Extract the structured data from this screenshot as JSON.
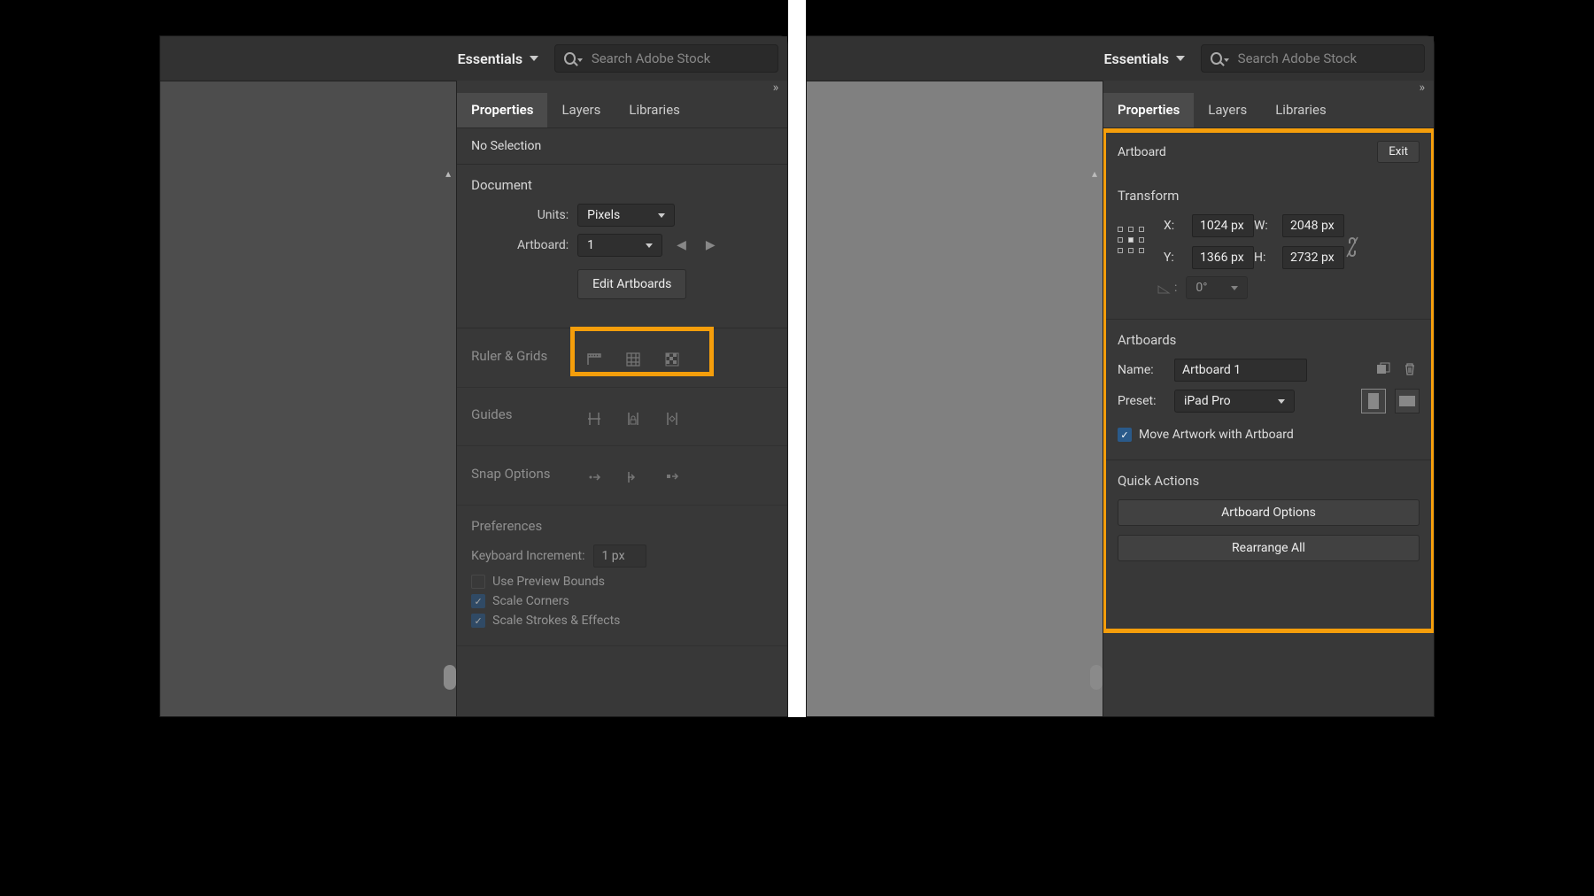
{
  "colors": {
    "highlight": "#f59e0b",
    "panel_bg": "#383838",
    "canvas_bg": "#4d4d4d"
  },
  "left": {
    "workspace_label": "Essentials",
    "search_placeholder": "Search Adobe Stock",
    "tabs": {
      "properties": "Properties",
      "layers": "Layers",
      "libraries": "Libraries"
    },
    "no_selection": "No Selection",
    "document": {
      "heading": "Document",
      "units_label": "Units:",
      "units_value": "Pixels",
      "artboard_label": "Artboard:",
      "artboard_value": "1",
      "edit_artboards_btn": "Edit Artboards"
    },
    "ruler_grids": "Ruler & Grids",
    "guides": "Guides",
    "snap_options": "Snap Options",
    "preferences": {
      "heading": "Preferences",
      "keyboard_inc_label": "Keyboard Increment:",
      "keyboard_inc_value": "1 px",
      "use_preview_bounds": "Use Preview Bounds",
      "scale_corners": "Scale Corners",
      "scale_strokes": "Scale Strokes & Effects"
    }
  },
  "right": {
    "workspace_label": "Essentials",
    "search_placeholder": "Search Adobe Stock",
    "tabs": {
      "properties": "Properties",
      "layers": "Layers",
      "libraries": "Libraries"
    },
    "artboard_title": "Artboard",
    "exit_btn": "Exit",
    "transform": {
      "heading": "Transform",
      "x_label": "X:",
      "x_value": "1024 px",
      "y_label": "Y:",
      "y_value": "1366 px",
      "w_label": "W:",
      "w_value": "2048 px",
      "h_label": "H:",
      "h_value": "2732 px",
      "rotation_value": "0°"
    },
    "artboards": {
      "heading": "Artboards",
      "name_label": "Name:",
      "name_value": "Artboard 1",
      "preset_label": "Preset:",
      "preset_value": "iPad Pro",
      "move_artwork": "Move Artwork with Artboard"
    },
    "quick_actions": {
      "heading": "Quick Actions",
      "artboard_options": "Artboard Options",
      "rearrange_all": "Rearrange All"
    }
  }
}
